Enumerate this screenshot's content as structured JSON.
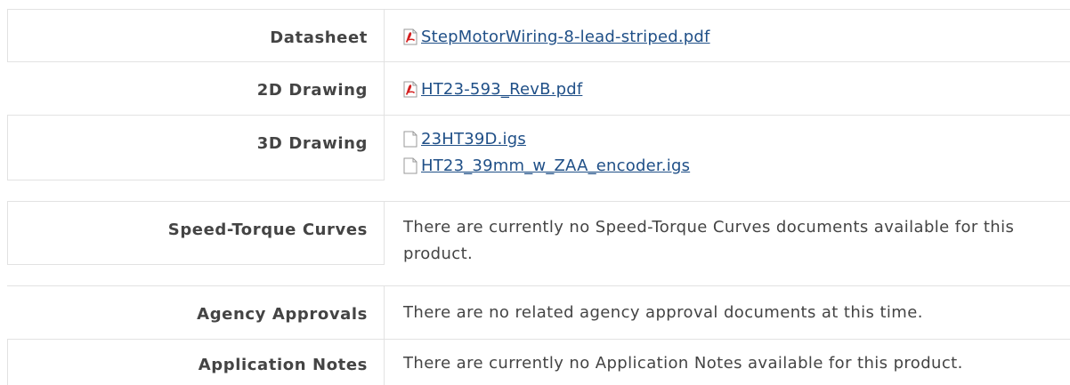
{
  "rows": [
    {
      "label": "Datasheet",
      "files": [
        {
          "name": "StepMotorWiring-8-lead-striped.pdf",
          "icon": "pdf-icon"
        }
      ]
    },
    {
      "label": "2D Drawing",
      "files": [
        {
          "name": "HT23-593_RevB.pdf",
          "icon": "pdf-icon"
        }
      ]
    },
    {
      "label": "3D Drawing",
      "files": [
        {
          "name": "23HT39D.igs",
          "icon": "file-icon"
        },
        {
          "name": "HT23_39mm_w_ZAA_encoder.igs",
          "icon": "file-icon"
        }
      ]
    },
    {
      "label": "Speed-Torque Curves",
      "message": "There are currently no Speed-Torque Curves documents available for this product."
    },
    {
      "label": "Agency Approvals",
      "message": "There are no related agency approval documents at this time."
    },
    {
      "label": "Application Notes",
      "message": "There are currently no Application Notes available for this product."
    }
  ],
  "colors": {
    "link": "#1f4f87",
    "label": "#444444",
    "border": "#e2e2e2",
    "pdf_accent": "#d41f1f"
  }
}
